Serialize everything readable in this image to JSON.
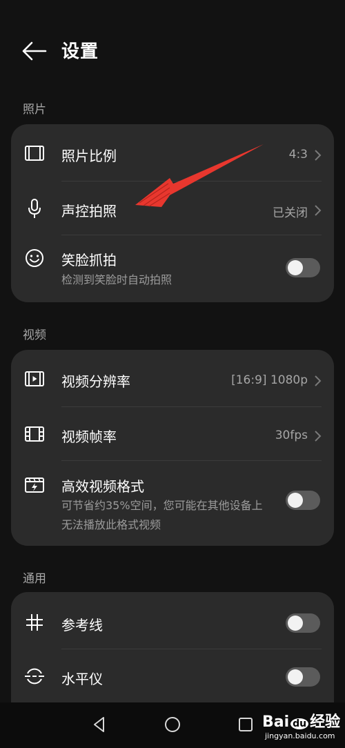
{
  "header": {
    "title": "设置"
  },
  "sections": {
    "photo": "照片",
    "video": "视频",
    "general": "通用"
  },
  "photo_items": {
    "ratio": {
      "label": "照片比例",
      "value": "4:3"
    },
    "voice": {
      "label": "声控拍照",
      "value": "已关闭"
    },
    "smile": {
      "label": "笑脸抓拍",
      "desc": "检测到笑脸时自动拍照",
      "enabled": false
    }
  },
  "video_items": {
    "resolution": {
      "label": "视频分辨率",
      "value": "[16:9] 1080p"
    },
    "framerate": {
      "label": "视频帧率",
      "value": "30fps"
    },
    "hevc": {
      "label": "高效视频格式",
      "desc": "可节省约35%空间，您可能在其他设备上无法播放此格式视频",
      "enabled": false
    }
  },
  "general_items": {
    "grid": {
      "label": "参考线",
      "enabled": false
    },
    "level": {
      "label": "水平仪",
      "enabled": false
    }
  },
  "watermark": {
    "brand": "Bai",
    "brand2": "du",
    "brand3": "经验",
    "url": "jingyan.baidu.com"
  },
  "colors": {
    "background": "#121212",
    "card": "#2b2b2b",
    "annotation_arrow": "#e8372e"
  }
}
